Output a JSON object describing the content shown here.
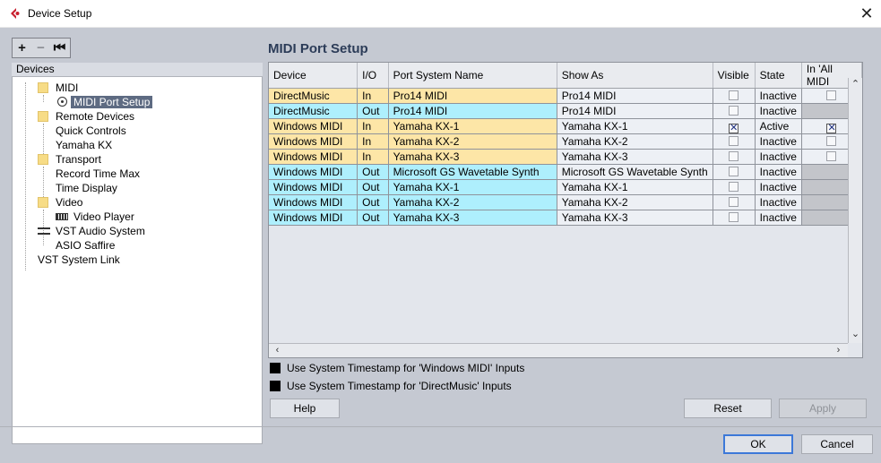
{
  "window": {
    "title": "Device Setup",
    "close_icon": "close-icon"
  },
  "toolbar": {
    "add": "+",
    "remove": "−",
    "reset_tree": "⏮"
  },
  "devices": {
    "header": "Devices",
    "tree": [
      {
        "label": "MIDI",
        "icon": "folder-icon"
      },
      {
        "label": "MIDI Port Setup",
        "icon": "midi-port-icon",
        "selected": true
      },
      {
        "label": "Remote Devices",
        "icon": "folder-icon"
      },
      {
        "label": "Quick Controls"
      },
      {
        "label": "Yamaha KX"
      },
      {
        "label": "Transport",
        "icon": "folder-icon"
      },
      {
        "label": "Record Time Max"
      },
      {
        "label": "Time Display"
      },
      {
        "label": "Video",
        "icon": "folder-icon"
      },
      {
        "label": "Video Player",
        "icon": "video-player-icon"
      },
      {
        "label": "VST Audio System",
        "icon": "vst-audio-icon"
      },
      {
        "label": "ASIO Saffire"
      },
      {
        "label": "VST System Link"
      }
    ]
  },
  "panel": {
    "title": "MIDI Port Setup"
  },
  "table": {
    "columns": [
      "Device",
      "I/O",
      "Port System Name",
      "Show As",
      "Visible",
      "State",
      "In 'All MIDI"
    ],
    "rows": [
      {
        "device": "DirectMusic",
        "io": "In",
        "port": "Pro14 MIDI",
        "show_as": "Pro14 MIDI",
        "visible": false,
        "state": "Inactive",
        "all_midi": false,
        "all_midi_enabled": true,
        "kind": "dm"
      },
      {
        "device": "DirectMusic",
        "io": "Out",
        "port": "Pro14 MIDI",
        "show_as": "Pro14 MIDI",
        "visible": false,
        "state": "Inactive",
        "all_midi": false,
        "all_midi_enabled": false,
        "kind": "out"
      },
      {
        "device": "Windows MIDI",
        "io": "In",
        "port": "Yamaha KX-1",
        "show_as": "Yamaha KX-1",
        "visible": true,
        "state": "Active",
        "all_midi": true,
        "all_midi_enabled": true,
        "kind": "dm"
      },
      {
        "device": "Windows MIDI",
        "io": "In",
        "port": "Yamaha KX-2",
        "show_as": "Yamaha KX-2",
        "visible": false,
        "state": "Inactive",
        "all_midi": false,
        "all_midi_enabled": true,
        "kind": "dm"
      },
      {
        "device": "Windows MIDI",
        "io": "In",
        "port": "Yamaha KX-3",
        "show_as": "Yamaha KX-3",
        "visible": false,
        "state": "Inactive",
        "all_midi": false,
        "all_midi_enabled": true,
        "kind": "dm"
      },
      {
        "device": "Windows MIDI",
        "io": "Out",
        "port": "Microsoft GS Wavetable Synth",
        "show_as": "Microsoft GS Wavetable Synth",
        "visible": false,
        "state": "Inactive",
        "all_midi": false,
        "all_midi_enabled": false,
        "kind": "out"
      },
      {
        "device": "Windows MIDI",
        "io": "Out",
        "port": "Yamaha KX-1",
        "show_as": "Yamaha KX-1",
        "visible": false,
        "state": "Inactive",
        "all_midi": false,
        "all_midi_enabled": false,
        "kind": "out"
      },
      {
        "device": "Windows MIDI",
        "io": "Out",
        "port": "Yamaha KX-2",
        "show_as": "Yamaha KX-2",
        "visible": false,
        "state": "Inactive",
        "all_midi": false,
        "all_midi_enabled": false,
        "kind": "out"
      },
      {
        "device": "Windows MIDI",
        "io": "Out",
        "port": "Yamaha KX-3",
        "show_as": "Yamaha KX-3",
        "visible": false,
        "state": "Inactive",
        "all_midi": false,
        "all_midi_enabled": false,
        "kind": "out"
      }
    ]
  },
  "options": {
    "timestamp_windows_midi": "Use System Timestamp for 'Windows MIDI' Inputs",
    "timestamp_directmusic": "Use System Timestamp for 'DirectMusic' Inputs"
  },
  "buttons": {
    "help": "Help",
    "reset": "Reset",
    "apply": "Apply",
    "ok": "OK",
    "cancel": "Cancel"
  },
  "colors": {
    "in_row": "#fde6a7",
    "out_row": "#aeeffd",
    "accent_title": "#2c3c58"
  }
}
